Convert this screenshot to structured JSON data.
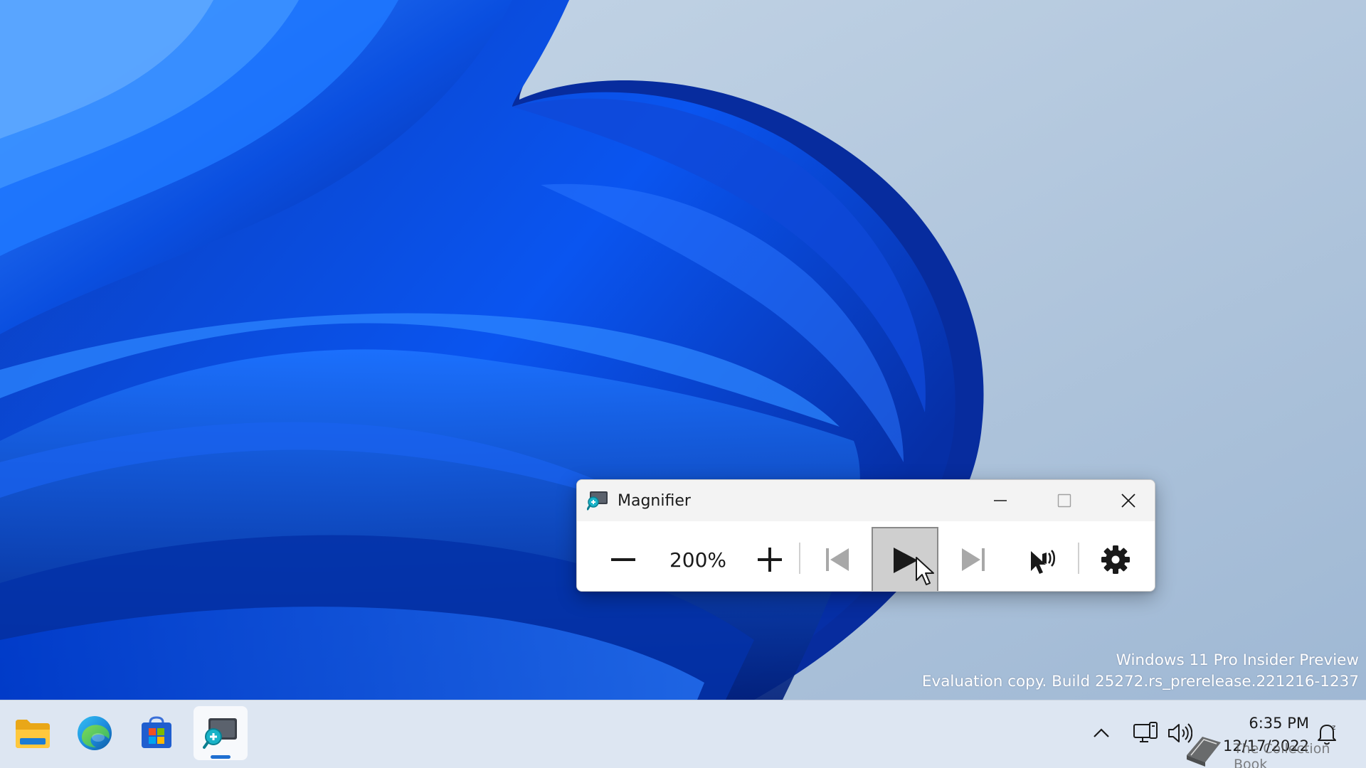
{
  "desktop": {
    "watermark": {
      "line1": "Windows 11 Pro Insider Preview",
      "line2": "Evaluation copy. Build 25272.rs_prerelease.221216-1237"
    }
  },
  "magnifier": {
    "title": "Magnifier",
    "zoom_level": "200%",
    "controls": [
      {
        "name": "zoom-out",
        "icon": "minus-icon"
      },
      {
        "name": "zoom-in",
        "icon": "plus-icon"
      },
      {
        "name": "read-previous",
        "icon": "skip-back-icon"
      },
      {
        "name": "play",
        "icon": "play-icon",
        "state": "pressed"
      },
      {
        "name": "read-next",
        "icon": "skip-forward-icon"
      },
      {
        "name": "read-from-here",
        "icon": "pointer-speaker-icon"
      },
      {
        "name": "settings",
        "icon": "gear-icon"
      }
    ]
  },
  "taskbar": {
    "apps": [
      {
        "name": "File Explorer",
        "icon": "folder-icon"
      },
      {
        "name": "Microsoft Edge",
        "icon": "edge-icon"
      },
      {
        "name": "Microsoft Store",
        "icon": "store-icon"
      },
      {
        "name": "Magnifier",
        "icon": "magnifier-icon",
        "active": true
      }
    ],
    "tray": {
      "icons": [
        "chevron-up-icon",
        "network-icon",
        "volume-icon",
        "notification-icon"
      ],
      "time": "6:35 PM",
      "date": "12/17/2022"
    }
  },
  "overlay": {
    "text": "The Collection Book"
  },
  "colors": {
    "accent": "#1f6fd1",
    "taskbar": "#dde6f2",
    "window_titlebar": "#f3f3f3"
  }
}
